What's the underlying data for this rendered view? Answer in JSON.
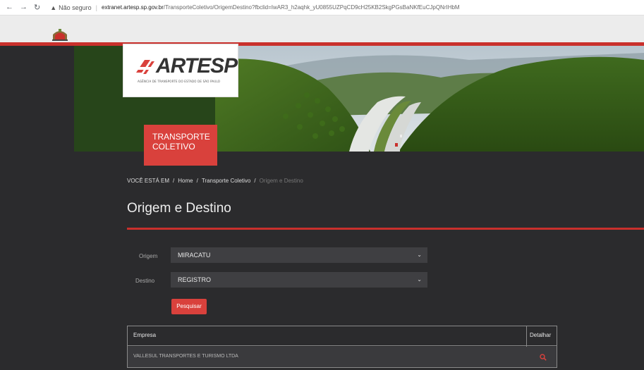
{
  "browser": {
    "security_label": "Não seguro",
    "url_host": "extranet.artesp.sp.gov.br",
    "url_path": "/TransporteColetivo/OrigemDestino?fbclid=IwAR3_h2aqhk_yU0855UZPqCD9cH25KB2SkgPGsBaNKfEuCJpQNrIHbM"
  },
  "logo": {
    "name": "ARTESP",
    "subtitle": "AGÊNCIA DE TRANSPORTE DO ESTADO DE SÃO PAULO"
  },
  "section_tag": "TRANSPORTE COLETIVO",
  "breadcrumb": {
    "prefix": "VOCÊ ESTÁ EM",
    "home": "Home",
    "section": "Transporte Coletivo",
    "current": "Origem e Destino"
  },
  "page_title": "Origem e Destino",
  "form": {
    "origin_label": "Origem",
    "origin_value": "MIRACATU",
    "destination_label": "Destino",
    "destination_value": "REGISTRO",
    "search_label": "Pesquisar"
  },
  "table": {
    "headers": [
      "Empresa",
      "Detalhar"
    ],
    "rows": [
      {
        "company": "VALLESUL TRANSPORTES E TURISMO LTDA"
      }
    ]
  },
  "colors": {
    "accent": "#d9413c",
    "background": "#2b2b2d"
  }
}
